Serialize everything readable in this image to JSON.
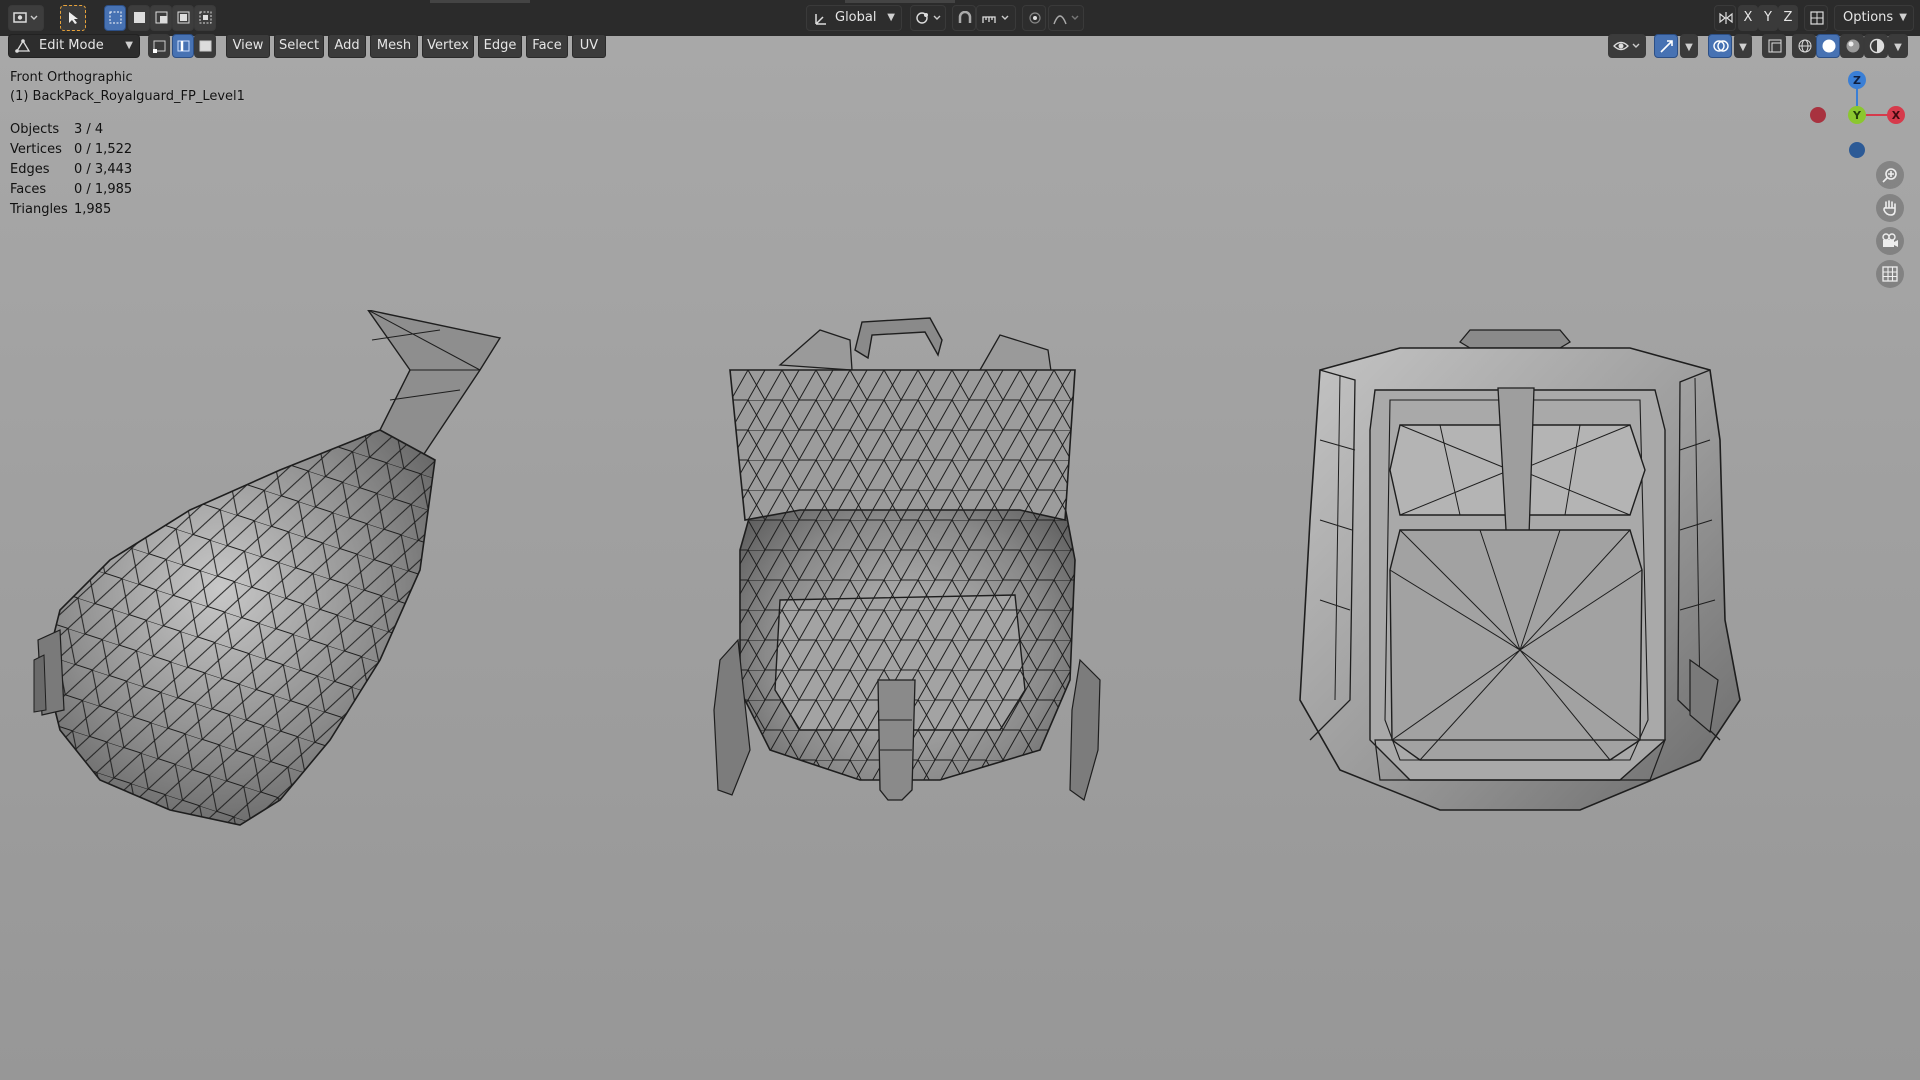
{
  "header": {
    "transform_orientation": "Global",
    "axis_labels": [
      "X",
      "Y",
      "Z"
    ],
    "options_label": "Options"
  },
  "toolbar": {
    "mode": "Edit Mode",
    "menus": [
      "View",
      "Select",
      "Add",
      "Mesh",
      "Vertex",
      "Edge",
      "Face",
      "UV"
    ]
  },
  "viewport": {
    "view_name": "Front Orthographic",
    "object_name": "(1) BackPack_Royalguard_FP_Level1",
    "stats": [
      {
        "label": "Objects",
        "value": "3 / 4"
      },
      {
        "label": "Vertices",
        "value": "0 / 1,522"
      },
      {
        "label": "Edges",
        "value": "0 / 3,443"
      },
      {
        "label": "Faces",
        "value": "0 / 1,985"
      },
      {
        "label": "Triangles",
        "value": "1,985"
      }
    ]
  },
  "gizmo": {
    "z_label": "Z",
    "y_label": "Y",
    "x_label": "X",
    "colors": {
      "x": "#d63a4b",
      "y": "#8bc72f",
      "z": "#3a7fd6"
    }
  },
  "icons": {
    "navigation": [
      "zoom-icon",
      "pan-hand-icon",
      "camera-icon",
      "grid-icon"
    ]
  }
}
